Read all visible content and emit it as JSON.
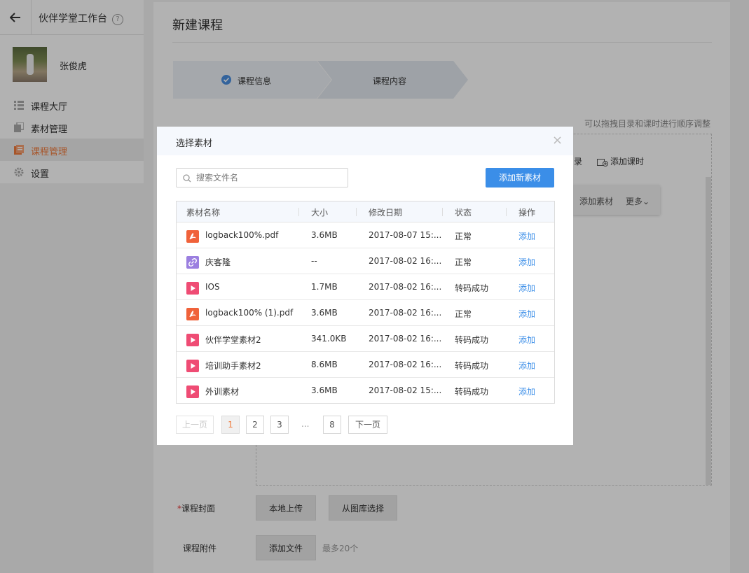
{
  "sidebar": {
    "app_title": "伙伴学堂工作台",
    "help_icon": "?",
    "user_name": "张俊虎",
    "items": [
      {
        "label": "课程大厅",
        "icon": "list-icon"
      },
      {
        "label": "素材管理",
        "icon": "copy-icon"
      },
      {
        "label": "课程管理",
        "icon": "book-icon",
        "active": true
      },
      {
        "label": "设置",
        "icon": "gear-icon"
      }
    ]
  },
  "main": {
    "page_title": "新建课程",
    "steps": [
      {
        "label": "课程信息",
        "done": true
      },
      {
        "label": "课程内容"
      }
    ],
    "hint": "可以拖拽目录和课时进行顺序调整",
    "toolbar": {
      "catalog_partial": "录",
      "add_lesson": "添加课时"
    },
    "float_menu": {
      "add_material": "添加素材",
      "more": "更多⌄"
    },
    "cover": {
      "label": "课程封面",
      "required_mark": "*",
      "local_upload": "本地上传",
      "from_gallery": "从图库选择"
    },
    "attachment": {
      "label": "课程附件",
      "add_file": "添加文件",
      "max_note": "最多20个"
    }
  },
  "modal": {
    "title": "选择素材",
    "close": "×",
    "search_placeholder": "搜索文件名",
    "add_new": "添加新素材",
    "columns": [
      "素材名称",
      "大小",
      "修改日期",
      "状态",
      "操作"
    ],
    "rows": [
      {
        "icon": "pdf-icon",
        "name": "logback100%.pdf",
        "size": "3.6MB",
        "date": "2017-08-07 15:...",
        "status": "正常",
        "op": "添加"
      },
      {
        "icon": "link-icon",
        "name": "庆客隆",
        "size": "--",
        "date": "2017-08-02 16:...",
        "status": "正常",
        "op": "添加"
      },
      {
        "icon": "video-icon",
        "name": "IOS",
        "size": "1.7MB",
        "date": "2017-08-02 16:...",
        "status": "转码成功",
        "op": "添加"
      },
      {
        "icon": "pdf-icon",
        "name": "logback100% (1).pdf",
        "size": "3.6MB",
        "date": "2017-08-02 16:...",
        "status": "正常",
        "op": "添加"
      },
      {
        "icon": "video-icon",
        "name": "伙伴学堂素材2",
        "size": "341.0KB",
        "date": "2017-08-02 16:...",
        "status": "转码成功",
        "op": "添加"
      },
      {
        "icon": "video-icon",
        "name": "培训助手素材2",
        "size": "8.6MB",
        "date": "2017-08-02 16:...",
        "status": "转码成功",
        "op": "添加"
      },
      {
        "icon": "video-icon",
        "name": "外训素材",
        "size": "3.6MB",
        "date": "2017-08-02 15:...",
        "status": "转码成功",
        "op": "添加"
      }
    ],
    "pager": {
      "prev": "上一页",
      "pages": [
        "1",
        "2",
        "3"
      ],
      "ellipsis": "...",
      "last": "8",
      "next": "下一页",
      "current": "1"
    }
  },
  "colors": {
    "accent": "#3b8ee8",
    "active_nav": "#f07a3c",
    "pdf": "#f0623a",
    "link": "#9b7fe0",
    "video": "#ef4c74"
  }
}
